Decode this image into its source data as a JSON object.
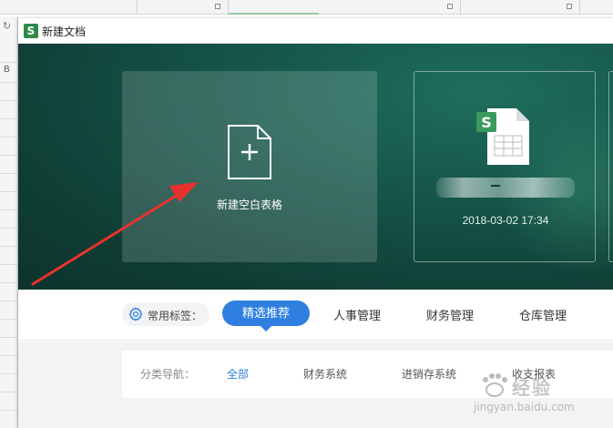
{
  "window": {
    "app_icon_letter": "S",
    "title": "新建文档"
  },
  "hero": {
    "blank_card_label": "新建空白表格",
    "recent_file": {
      "date": "2018-03-02 17:34"
    }
  },
  "tagbar": {
    "common_tags_label": "常用标签：",
    "tabs": [
      {
        "label": "精选推荐",
        "active": true
      },
      {
        "label": "人事管理",
        "active": false
      },
      {
        "label": "财务管理",
        "active": false
      },
      {
        "label": "仓库管理",
        "active": false
      }
    ]
  },
  "category_nav": {
    "label": "分类导航：",
    "items": [
      {
        "label": "全部",
        "active": true
      },
      {
        "label": "财务系统",
        "active": false
      },
      {
        "label": "进销存系统",
        "active": false
      },
      {
        "label": "收支报表",
        "active": false
      }
    ]
  },
  "watermark": {
    "text": "经验",
    "url": "jingyan.baidu.com"
  },
  "colors": {
    "accent_blue": "#2f7fe0",
    "hero_green": "#16574a",
    "brand_green": "#2f8a4a",
    "annotation_red": "#e8322d"
  },
  "icons": [
    "app-logo-icon",
    "new-document-icon",
    "spreadsheet-file-icon",
    "gear-icon"
  ]
}
